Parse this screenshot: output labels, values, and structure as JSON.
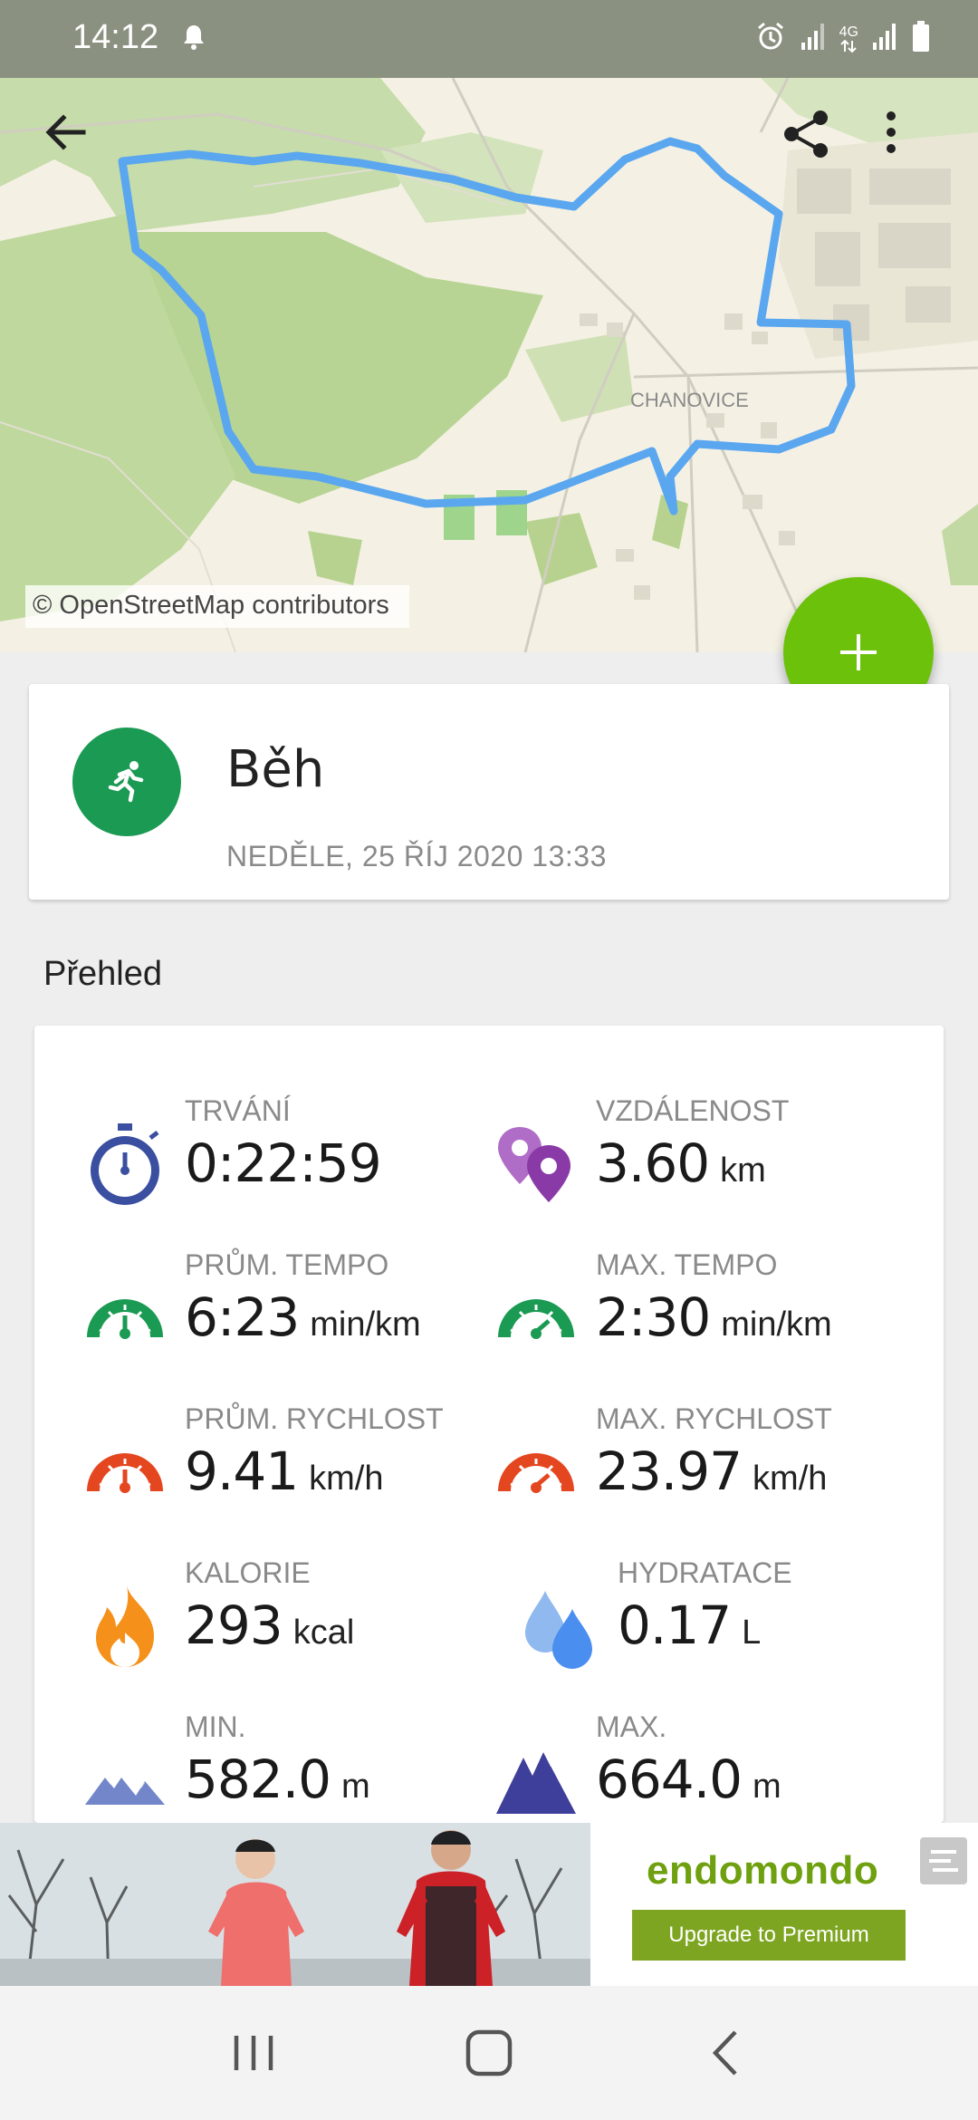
{
  "status_bar": {
    "time": "14:12",
    "icons": [
      "bell-icon",
      "alarm-icon",
      "signal-icon",
      "4g-icon",
      "signal-icon-2",
      "battery-icon"
    ],
    "network_label": "4G"
  },
  "map": {
    "place_label": "CHANOVICE",
    "credit": "© OpenStreetMap contributors",
    "route_color": "#5aa7f0"
  },
  "workout": {
    "sport": "Běh",
    "date": "NEDĚLE, 25 ŘÍJ 2020 13:33",
    "avatar_color": "#1b9a53"
  },
  "overview": {
    "title": "Přehled",
    "stats": [
      {
        "label": "TRVÁNÍ",
        "value": "0:22:59",
        "unit": "",
        "icon": "stopwatch-icon"
      },
      {
        "label": "VZDÁLENOST",
        "value": "3.60",
        "unit": "km",
        "icon": "location-pins-icon"
      },
      {
        "label": "PRŮM. TEMPO",
        "value": "6:23",
        "unit": "min/km",
        "icon": "gauge-green-icon"
      },
      {
        "label": "MAX. TEMPO",
        "value": "2:30",
        "unit": "min/km",
        "icon": "gauge-green-max-icon"
      },
      {
        "label": "PRŮM. RYCHLOST",
        "value": "9.41",
        "unit": "km/h",
        "icon": "gauge-red-icon"
      },
      {
        "label": "MAX. RYCHLOST",
        "value": "23.97",
        "unit": "km/h",
        "icon": "gauge-red-max-icon"
      },
      {
        "label": "KALORIE",
        "value": "293",
        "unit": "kcal",
        "icon": "flame-icon"
      },
      {
        "label": "HYDRATACE",
        "value": "0.17",
        "unit": "L",
        "icon": "water-drops-icon"
      },
      {
        "label": "MIN.",
        "value": "582.0",
        "unit": "m",
        "icon": "mountains-light-icon"
      },
      {
        "label": "MAX.",
        "value": "664.0",
        "unit": "m",
        "icon": "mountains-dark-icon"
      }
    ]
  },
  "ad": {
    "brand": "endomondo",
    "cta": "Upgrade to Premium"
  },
  "colors": {
    "accent_green": "#6cc10b",
    "gauge_green": "#1b9a53",
    "gauge_red": "#e4461f",
    "stopwatch_blue": "#3a4fa0",
    "pin_purple": "#8a3aa6",
    "flame_orange": "#f5901a",
    "drop_blue": "#4a8ff0",
    "mountain_dark": "#3d3f9a",
    "mountain_light": "#7286c9"
  }
}
